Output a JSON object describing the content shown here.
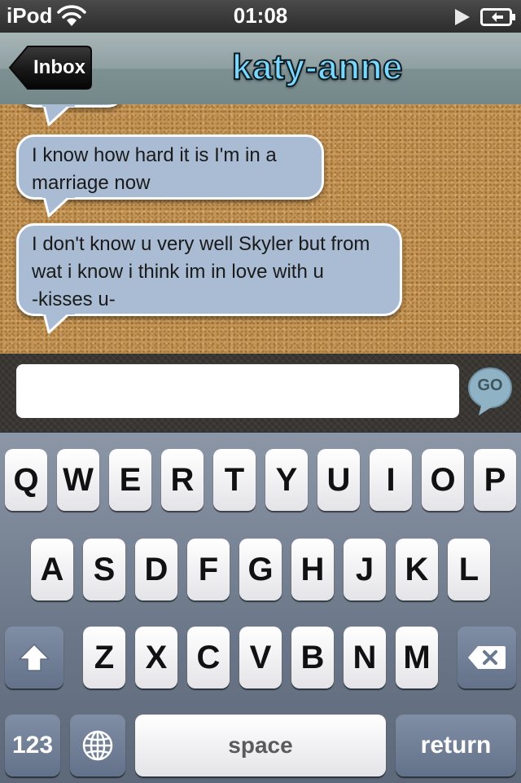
{
  "status_bar": {
    "carrier": "iPod",
    "time": "01:08",
    "icons": [
      "wifi-icon",
      "play-icon",
      "battery-icon"
    ]
  },
  "nav": {
    "back_label": "Inbox",
    "title": "katy-anne"
  },
  "messages": [
    {
      "text": "I know how hard it is I'm in a marriage now"
    },
    {
      "text": "I don't know u very well Skyler but from wat i know i think im in love with u            -kisses u-"
    }
  ],
  "input": {
    "value": "",
    "go_label": "GO"
  },
  "keyboard": {
    "row1": [
      "Q",
      "W",
      "E",
      "R",
      "T",
      "Y",
      "U",
      "I",
      "O",
      "P"
    ],
    "row2": [
      "A",
      "S",
      "D",
      "F",
      "G",
      "H",
      "J",
      "K",
      "L"
    ],
    "row3": [
      "Z",
      "X",
      "C",
      "V",
      "B",
      "N",
      "M"
    ],
    "numbers_label": "123",
    "space_label": "space",
    "return_label": "return",
    "icons": [
      "shift-icon",
      "backspace-icon",
      "globe-icon"
    ]
  },
  "colors": {
    "title": "#79d8ff",
    "bubble": "#a9bcd4",
    "cork": "#c49555"
  }
}
